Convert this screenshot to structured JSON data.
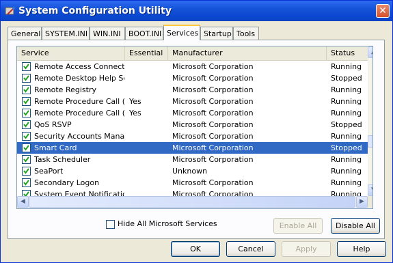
{
  "window": {
    "title": "System Configuration Utility",
    "close_glyph": "✕"
  },
  "tabs": [
    "General",
    "SYSTEM.INI",
    "WIN.INI",
    "BOOT.INI",
    "Services",
    "Startup",
    "Tools"
  ],
  "active_tab": "Services",
  "columns": [
    "Service",
    "Essential",
    "Manufacturer",
    "Status"
  ],
  "rows": [
    {
      "service": "Remote Access Connecti...",
      "essential": "",
      "manufacturer": "Microsoft Corporation",
      "status": "Running",
      "checked": true
    },
    {
      "service": "Remote Desktop Help Se...",
      "essential": "",
      "manufacturer": "Microsoft Corporation",
      "status": "Stopped",
      "checked": true
    },
    {
      "service": "Remote Registry",
      "essential": "",
      "manufacturer": "Microsoft Corporation",
      "status": "Running",
      "checked": true
    },
    {
      "service": "Remote Procedure Call (...",
      "essential": "Yes",
      "manufacturer": "Microsoft Corporation",
      "status": "Running",
      "checked": true
    },
    {
      "service": "Remote Procedure Call (...",
      "essential": "Yes",
      "manufacturer": "Microsoft Corporation",
      "status": "Running",
      "checked": true
    },
    {
      "service": "QoS RSVP",
      "essential": "",
      "manufacturer": "Microsoft Corporation",
      "status": "Stopped",
      "checked": true
    },
    {
      "service": "Security Accounts Manager",
      "essential": "",
      "manufacturer": "Microsoft Corporation",
      "status": "Running",
      "checked": true
    },
    {
      "service": "Smart Card",
      "essential": "",
      "manufacturer": "Microsoft Corporation",
      "status": "Stopped",
      "checked": true,
      "selected": true
    },
    {
      "service": "Task Scheduler",
      "essential": "",
      "manufacturer": "Microsoft Corporation",
      "status": "Running",
      "checked": true
    },
    {
      "service": "SeaPort",
      "essential": "",
      "manufacturer": "Unknown",
      "status": "Running",
      "checked": true
    },
    {
      "service": "Secondary Logon",
      "essential": "",
      "manufacturer": "Microsoft Corporation",
      "status": "Running",
      "checked": true
    },
    {
      "service": "System Event Notification",
      "essential": "",
      "manufacturer": "Microsoft Corporation",
      "status": "Running",
      "checked": true
    }
  ],
  "scroll_icons": {
    "up": "▲",
    "down": "▼",
    "left": "◀",
    "right": "▶"
  },
  "hide_ms": {
    "label": "Hide All Microsoft Services",
    "checked": false
  },
  "buttons": {
    "enable_all": "Enable All",
    "disable_all": "Disable All",
    "ok": "OK",
    "cancel": "Cancel",
    "apply": "Apply",
    "help": "Help"
  },
  "colors": {
    "title_bar": "#0A46CF",
    "selection": "#316AC5",
    "active_tab_accent": "#FFC83C"
  }
}
